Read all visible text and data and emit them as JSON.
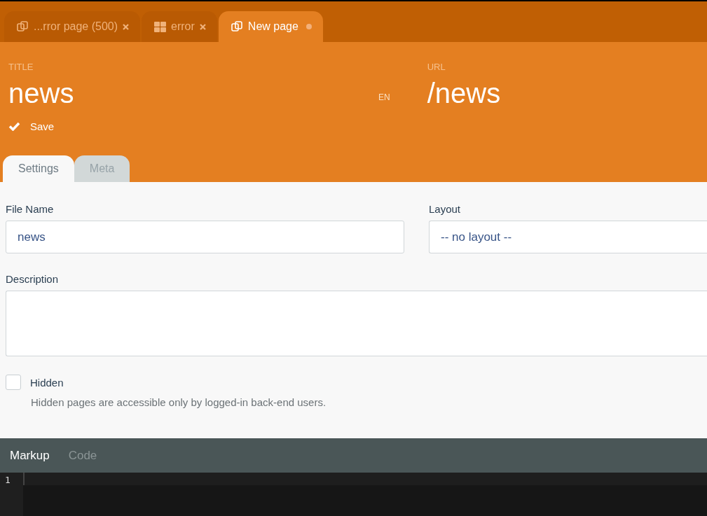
{
  "document_tabs": [
    {
      "label": "...rror page (500)",
      "kind": "page",
      "selected": false,
      "modified": false
    },
    {
      "label": "error",
      "kind": "layout",
      "selected": false,
      "modified": false
    },
    {
      "label": "New page",
      "kind": "page",
      "selected": true,
      "modified": true
    }
  ],
  "header": {
    "title_label": "TITLE",
    "title": "news",
    "locale": "EN",
    "url_label": "URL",
    "url": "/news",
    "save": "Save"
  },
  "form_tabs": [
    {
      "label": "Settings",
      "selected": true
    },
    {
      "label": "Meta",
      "selected": false
    }
  ],
  "form": {
    "file_name": {
      "label": "File Name",
      "value": "news"
    },
    "layout": {
      "label": "Layout",
      "value": "-- no layout --"
    },
    "description": {
      "label": "Description"
    },
    "hidden": {
      "label": "Hidden",
      "checked": false,
      "help": "Hidden pages are accessible only by logged-in back-end users."
    }
  },
  "editor_tabs": [
    {
      "label": "Markup",
      "selected": true
    },
    {
      "label": "Code",
      "selected": false
    }
  ],
  "editor": {
    "line_numbers": [
      "1"
    ]
  }
}
